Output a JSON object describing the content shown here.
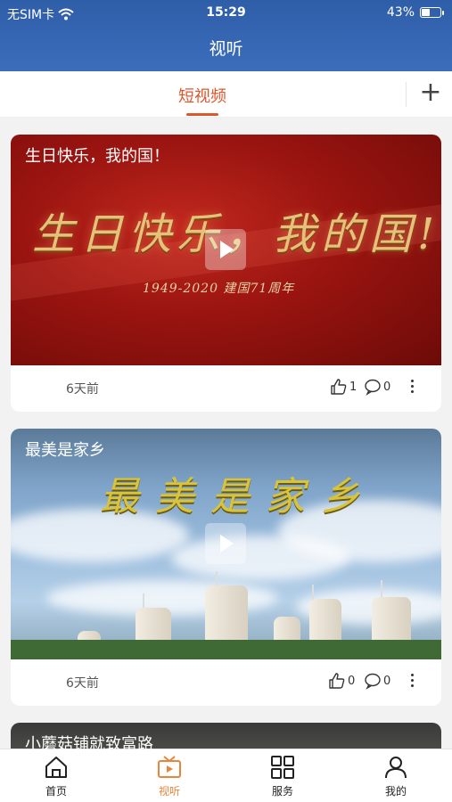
{
  "status_bar": {
    "carrier": "无SIM卡",
    "time": "15:29",
    "battery_percent": "43%",
    "battery_level": 0.43
  },
  "header": {
    "title": "视听"
  },
  "tabs": {
    "active_label": "短视频",
    "add_icon": "plus-icon"
  },
  "feed": [
    {
      "title": "生日快乐，我的国！",
      "overlay_text": "生日快乐，我的国!",
      "overlay_sub": "1949-2020 建国71周年",
      "time_ago": "6天前",
      "likes": "1",
      "comments": "0"
    },
    {
      "title": "最美是家乡",
      "overlay_text": "最美是家乡",
      "time_ago": "6天前",
      "likes": "0",
      "comments": "0"
    },
    {
      "title": "小蘑菇铺就致富路"
    }
  ],
  "bottom_nav": [
    {
      "label": "首页",
      "icon": "home-icon"
    },
    {
      "label": "视听",
      "icon": "video-icon",
      "active": true
    },
    {
      "label": "服务",
      "icon": "grid-icon"
    },
    {
      "label": "我的",
      "icon": "user-icon"
    }
  ],
  "colors": {
    "header_blue": "#2f5ea8",
    "accent": "#e0562c",
    "nav_active": "#e8853a"
  }
}
